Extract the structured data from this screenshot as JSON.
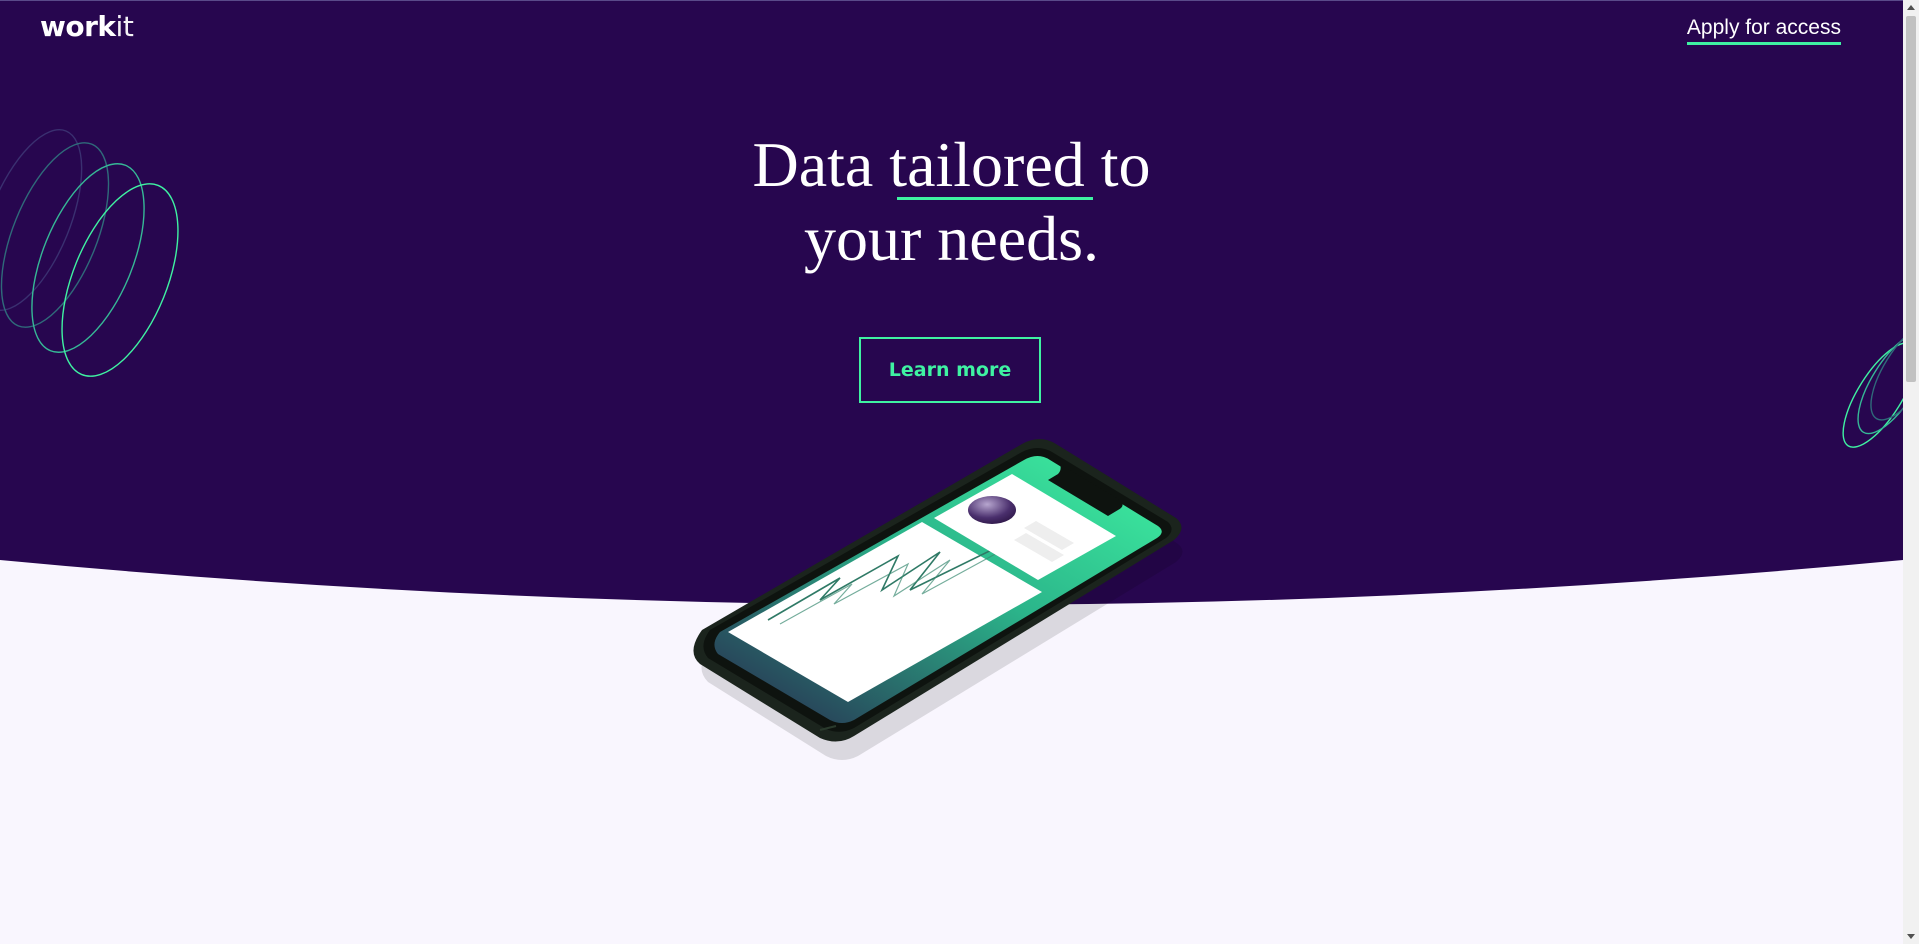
{
  "brand": {
    "logo_bold": "work",
    "logo_light": "it"
  },
  "nav": {
    "apply_label": "Apply for access"
  },
  "hero": {
    "headline_part1": "Data ",
    "headline_highlight": "tailored",
    "headline_part2": " to",
    "headline_line2": "your needs.",
    "cta_label": "Learn more"
  },
  "colors": {
    "hero_background": "#27064f",
    "page_background": "#f9f6fe",
    "accent": "#3ff2a2",
    "text_on_dark": "#ffffff"
  },
  "icons": {
    "left_decoration": "swirl-rings-icon",
    "right_decoration": "swirl-rings-icon",
    "hero_image": "phone-illustration",
    "scroll_up": "chevron-up-icon",
    "scroll_down": "chevron-down-icon"
  }
}
